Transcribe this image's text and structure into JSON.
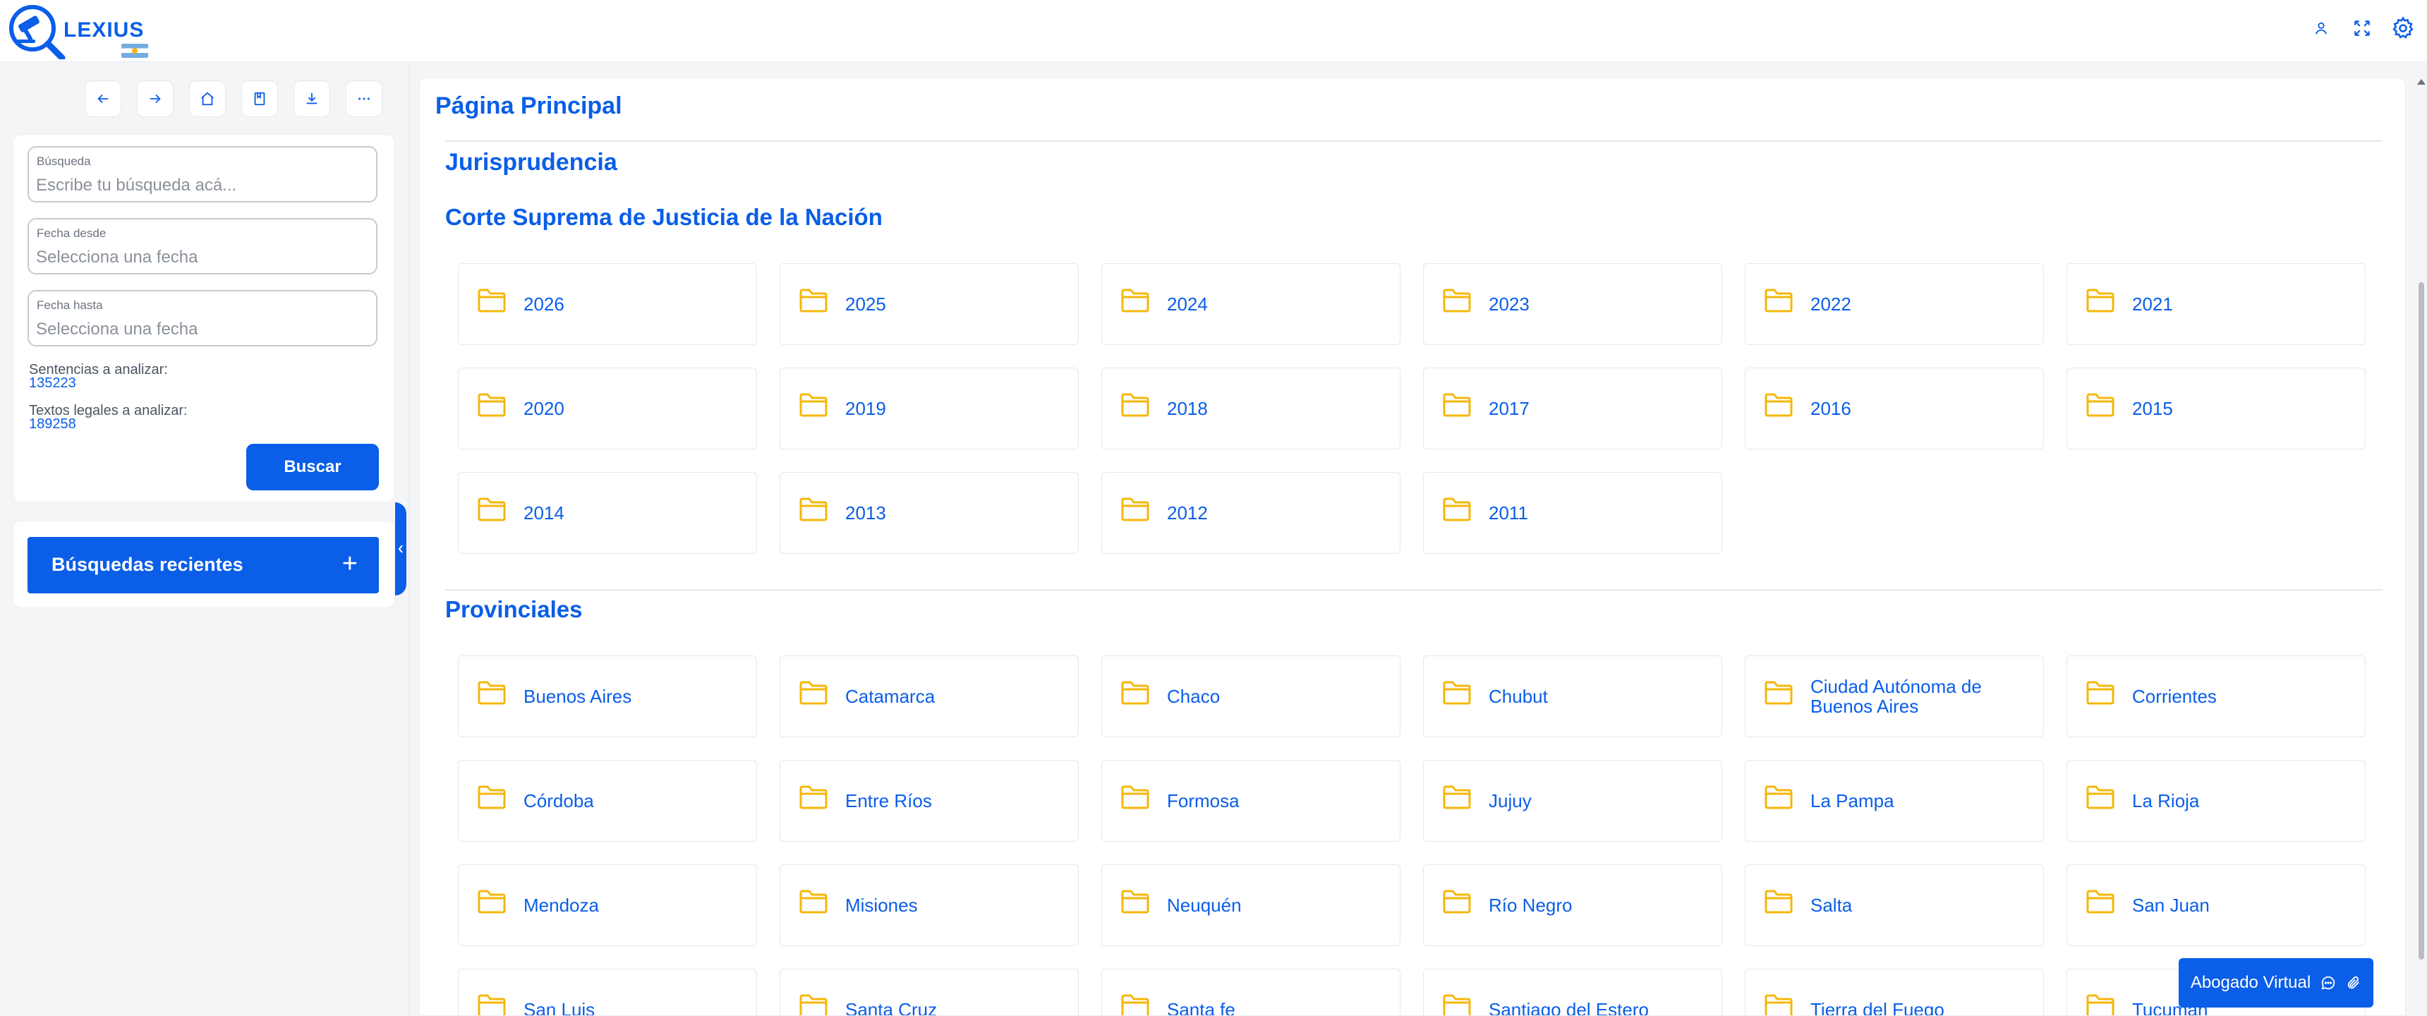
{
  "app": {
    "logo_text": "LEXIUS"
  },
  "icons": {
    "user": "user-icon",
    "fullscreen": "expand-icon",
    "settings": "gear-icon",
    "folder": "folder-icon",
    "chat": "chat-bubble-icon",
    "link": "paperclip-icon"
  },
  "colors": {
    "primary": "#0a5ee8",
    "folder": "#f5b70a",
    "background": "#f4f5f7"
  },
  "sidebar": {
    "fields": {
      "query": {
        "label": "Búsqueda",
        "placeholder": "Escribe tu búsqueda acá...",
        "value": ""
      },
      "date_from": {
        "label": "Fecha desde",
        "placeholder": "Selecciona una fecha",
        "value": ""
      },
      "date_to": {
        "label": "Fecha hasta",
        "placeholder": "Selecciona una fecha",
        "value": ""
      }
    },
    "stats": {
      "sentences_label": "Sentencias a analizar:",
      "sentences_value": "135223",
      "texts_label": "Textos legales a analizar:",
      "texts_value": "189258"
    },
    "search_button": "Buscar",
    "recent_label": "Búsquedas recientes",
    "recent_plus": "+"
  },
  "main": {
    "page_title": "Página Principal",
    "section_jurisprudencia": "Jurisprudencia",
    "section_corte": "Corte Suprema de Justicia de la Nación",
    "section_provinciales": "Provinciales",
    "years": [
      "2026",
      "2025",
      "2024",
      "2023",
      "2022",
      "2021",
      "2020",
      "2019",
      "2018",
      "2017",
      "2016",
      "2015",
      "2014",
      "2013",
      "2012",
      "2011"
    ],
    "provinces": [
      "Buenos Aires",
      "Catamarca",
      "Chaco",
      "Chubut",
      "Ciudad Autónoma de Buenos Aires",
      "Corrientes",
      "Córdoba",
      "Entre Ríos",
      "Formosa",
      "Jujuy",
      "La Pampa",
      "La Rioja",
      "Mendoza",
      "Misiones",
      "Neuquén",
      "Río Negro",
      "Salta",
      "San Juan",
      "San Luis",
      "Santa Cruz",
      "Santa fe",
      "Santiago del Estero",
      "Tierra del Fuego",
      "Tucumán"
    ]
  },
  "floating": {
    "abogado_label": "Abogado Virtual"
  }
}
